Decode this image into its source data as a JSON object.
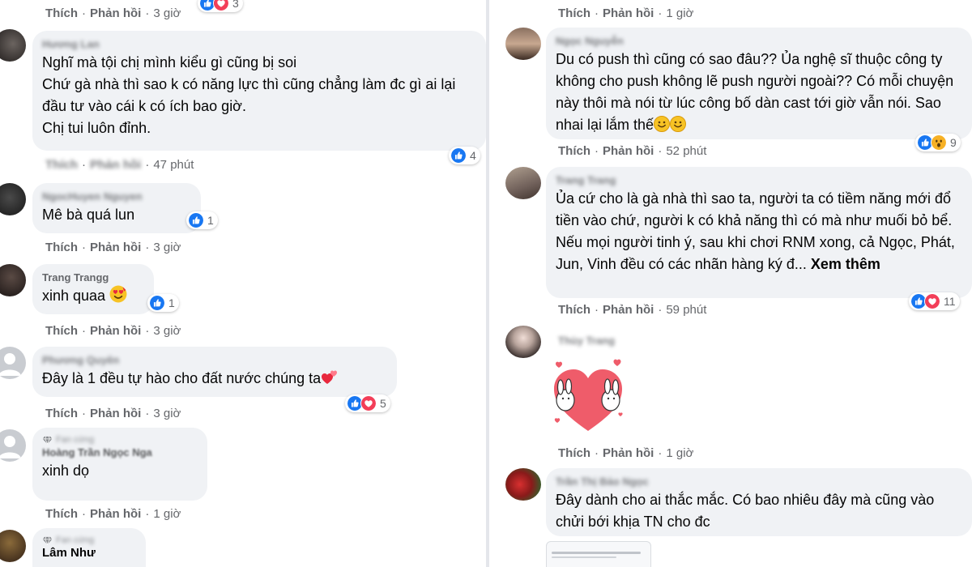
{
  "actions": {
    "like": "Thích",
    "reply": "Phản hồi",
    "sep": "·"
  },
  "left": {
    "top_row": {
      "time": "3 giờ",
      "reaction_count": "3"
    },
    "comments": [
      {
        "name": "Hương Lan",
        "text": "Nghĩ mà tội chị mình kiểu gì cũng bị soi\nChứ gà nhà thì sao k có năng lực thì cũng chẳng làm đc gì ai lại đầu tư vào cái k có ích bao giờ.\nChị tui luôn đỉnh.",
        "time": "47 phút",
        "reaction_count": "4"
      },
      {
        "name": "NgocHuyen Nguyen",
        "text": "Mê bà quá lun",
        "time": "3 giờ",
        "reaction_count": "1"
      },
      {
        "name": "Trang Trangg",
        "text": "xinh quaa",
        "time": "3 giờ",
        "reaction_count": "1"
      },
      {
        "name": "Phương Quyên",
        "text": "Đây là 1 đều tự hào cho đất nước chúng ta",
        "time": "3 giờ",
        "reaction_count": "5"
      },
      {
        "badge": "Fan cứng",
        "name": "Hoàng Trần Ngọc Nga",
        "text": "xinh dọ",
        "time": "1 giờ"
      },
      {
        "badge": "Fan cứng",
        "name": "Lâm Như"
      }
    ]
  },
  "right": {
    "top_row": {
      "time": "1 giờ"
    },
    "comments": [
      {
        "name": "Ngọc Nguyễn",
        "text": "Du có push thì cũng có sao đâu?? Ủa nghệ sĩ thuộc công ty không cho push không lẽ push người ngoài?? Có mỗi chuyện này thôi mà nói từ lúc công bố dàn cast tới giờ vẫn nói. Sao nhai lại lắm thế",
        "time": "52 phút",
        "reaction_count": "9"
      },
      {
        "name": "Trang Trang",
        "text": "Ủa cứ cho là gà nhà thì sao ta, người ta có tiềm năng mới đổ tiền vào chứ, người k có khả năng thì có mà như muối bỏ bể. Nếu mọi người tinh ý, sau khi chơi RNM xong, cả Ngọc, Phát, Jun, Vinh đều có các nhãn hàng ký đ...",
        "more": "Xem thêm",
        "time": "59 phút",
        "reaction_count": "11"
      },
      {
        "name": "Thùy Trang",
        "time": "1 giờ"
      },
      {
        "name": "Trần Thị Bảo Ngọc",
        "text": "Đây dành cho ai thắc mắc. Có bao nhiêu đây mà cũng vào chửi bới khịa TN cho đc"
      }
    ]
  },
  "colors": {
    "like_blue": "#1877f2",
    "love_red": "#f33e58",
    "haha_yellow": "#f7b125",
    "bubble": "#f0f2f5",
    "meta_gray": "#65676b"
  }
}
